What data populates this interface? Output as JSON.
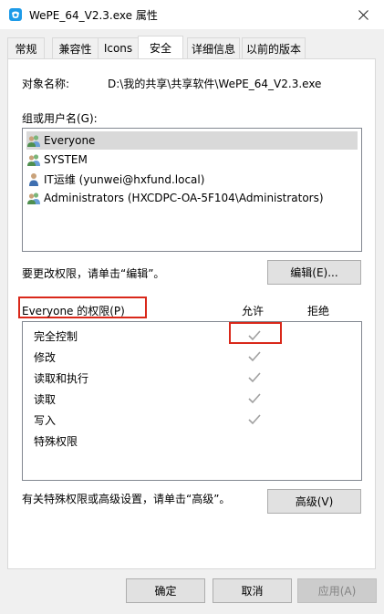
{
  "window": {
    "title": "WePE_64_V2.3.exe 属性",
    "close_glyph": "✕"
  },
  "tabs": [
    {
      "label": "常规",
      "active": false
    },
    {
      "label": "兼容性",
      "active": false
    },
    {
      "label": "Icons",
      "active": false
    },
    {
      "label": "安全",
      "active": true
    },
    {
      "label": "详细信息",
      "active": false
    },
    {
      "label": "以前的版本",
      "active": false
    }
  ],
  "security": {
    "object_name_label": "对象名称:",
    "object_name_value": "D:\\我的共享\\共享软件\\WePE_64_V2.3.exe",
    "groups_label": "组或用户名(G):",
    "groups": [
      {
        "name": "Everyone",
        "icon": "group-icon",
        "selected": true
      },
      {
        "name": "SYSTEM",
        "icon": "group-icon",
        "selected": false
      },
      {
        "name": "IT运维 (yunwei@hxfund.local)",
        "icon": "user-icon",
        "selected": false
      },
      {
        "name": "Administrators (HXCDPC-OA-5F104\\Administrators)",
        "icon": "group-icon",
        "selected": false
      }
    ],
    "edit_hint": "要更改权限，请单击“编辑”。",
    "edit_button": "编辑(E)...",
    "permissions_label": "Everyone 的权限(P)",
    "allow_header": "允许",
    "deny_header": "拒绝",
    "permissions": [
      {
        "name": "完全控制",
        "allow": true,
        "deny": false
      },
      {
        "name": "修改",
        "allow": true,
        "deny": false
      },
      {
        "name": "读取和执行",
        "allow": true,
        "deny": false
      },
      {
        "name": "读取",
        "allow": true,
        "deny": false
      },
      {
        "name": "写入",
        "allow": true,
        "deny": false
      },
      {
        "name": "特殊权限",
        "allow": false,
        "deny": false
      }
    ],
    "advanced_hint": "有关特殊权限或高级设置，请单击“高级”。",
    "advanced_button": "高级(V)"
  },
  "footer": {
    "ok": "确定",
    "cancel": "取消",
    "apply": "应用(A)"
  },
  "colors": {
    "highlight_border": "#d9281a",
    "check_gray": "#a0a0a0"
  }
}
